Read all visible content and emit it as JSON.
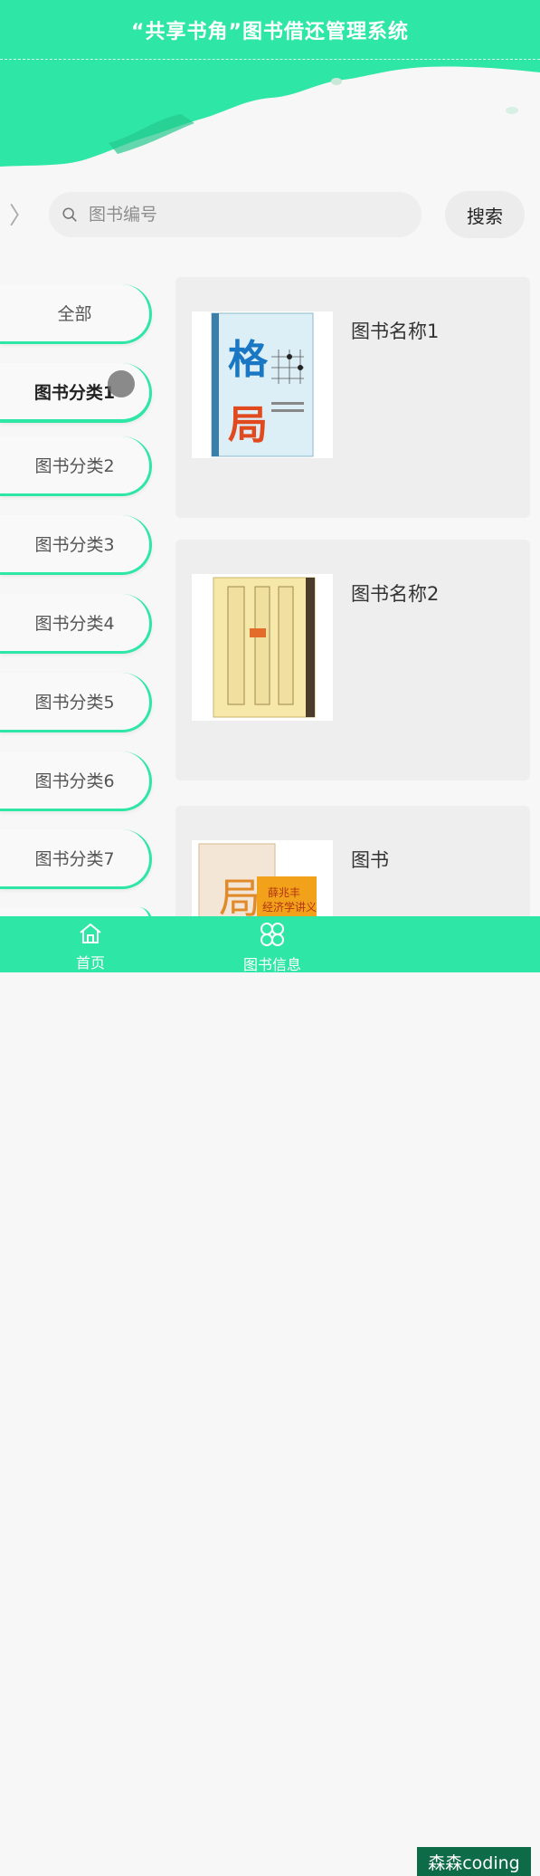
{
  "header": {
    "title": "“共享书角”图书借还管理系统"
  },
  "search": {
    "placeholder": "图书编号",
    "button_label": "搜索"
  },
  "categories": [
    {
      "label": "全部",
      "active": false
    },
    {
      "label": "图书分类1",
      "active": true
    },
    {
      "label": "图书分类2",
      "active": false
    },
    {
      "label": "图书分类3",
      "active": false
    },
    {
      "label": "图书分类4",
      "active": false
    },
    {
      "label": "图书分类5",
      "active": false
    },
    {
      "label": "图书分类6",
      "active": false
    },
    {
      "label": "图书分类7",
      "active": false
    }
  ],
  "books": [
    {
      "name": "图书名称1",
      "cover_text": "格局"
    },
    {
      "name": "图书名称2",
      "cover_text": ""
    },
    {
      "name": "图书",
      "cover_text": "局 薛兆丰经济学讲义"
    }
  ],
  "bottom_nav": [
    {
      "label": "首页",
      "icon": "home-icon"
    },
    {
      "label": "图书信息",
      "icon": "grid-icon"
    }
  ],
  "watermark": "森森coding",
  "colors": {
    "accent": "#2ee6a6",
    "watermark_bg": "#0e6b47"
  }
}
